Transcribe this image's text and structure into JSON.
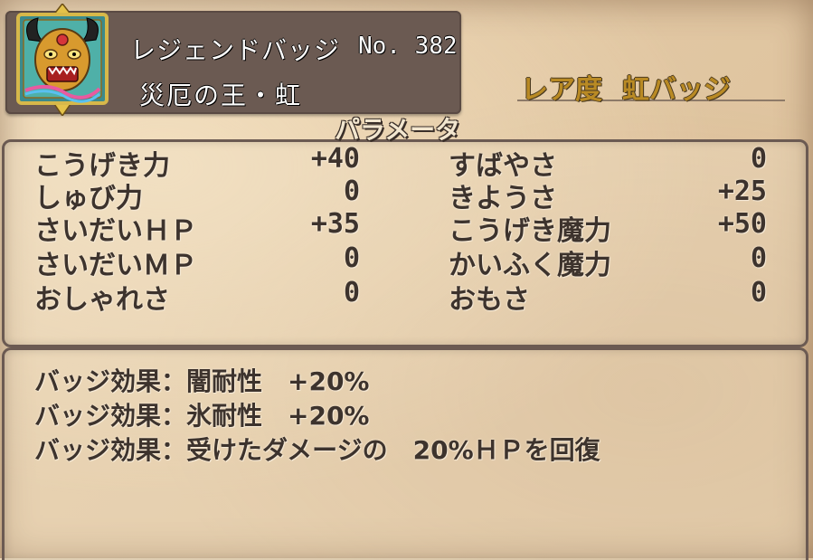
{
  "badge": {
    "name": "レジェンドバッジ",
    "number": "No. 382",
    "subtitle": "災厄の王・虹",
    "icon": "demon-king-badge-icon"
  },
  "rarity": {
    "label": "レア度",
    "value": "虹バッジ"
  },
  "params": {
    "title": "パラメータ",
    "left": [
      {
        "name": "こうげき力",
        "value": "+40"
      },
      {
        "name": "しゅび力",
        "value": "0"
      },
      {
        "name": "さいだいＨＰ",
        "value": "+35"
      },
      {
        "name": "さいだいＭＰ",
        "value": "0"
      },
      {
        "name": "おしゃれさ",
        "value": "0"
      }
    ],
    "right": [
      {
        "name": "すばやさ",
        "value": "0"
      },
      {
        "name": "きようさ",
        "value": "+25"
      },
      {
        "name": "こうげき魔力",
        "value": "+50"
      },
      {
        "name": "かいふく魔力",
        "value": "0"
      },
      {
        "name": "おもさ",
        "value": "0"
      }
    ]
  },
  "effects": [
    "バッジ効果：闇耐性　+20%",
    "バッジ効果：氷耐性　+20%",
    "バッジ効果：受けたダメージの　20%ＨＰを回復"
  ],
  "colors": {
    "header_plate": "#6b5a52",
    "rarity_gold": "#b98a24",
    "text_dark": "#3d332d"
  }
}
